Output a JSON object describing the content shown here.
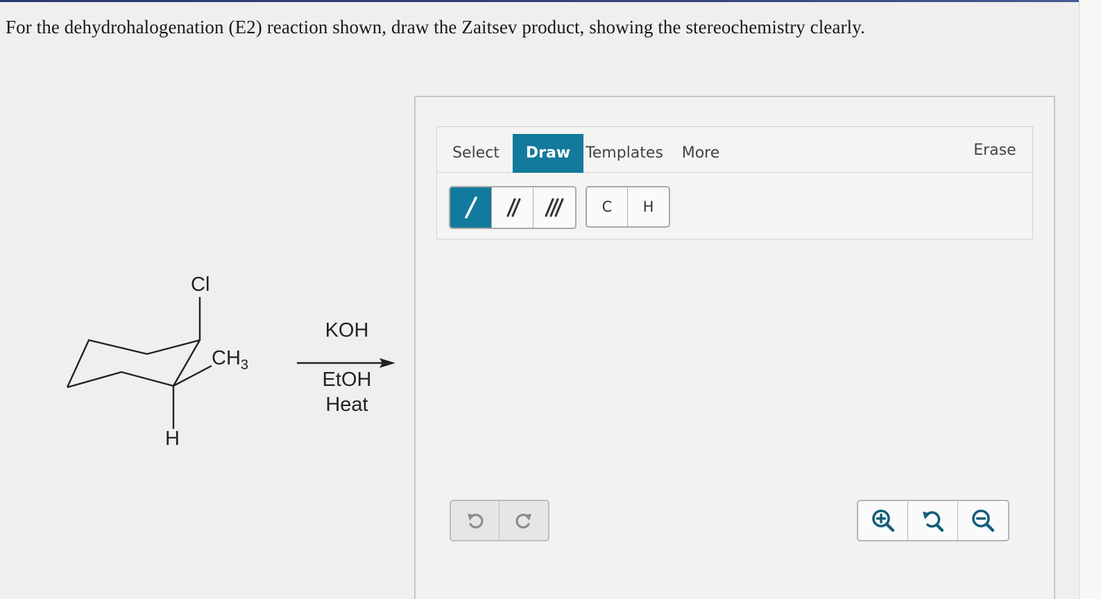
{
  "question": {
    "text": "For the dehydrohalogenation (E2) reaction shown, draw the Zaitsev product, showing the stereochemistry clearly."
  },
  "reactant": {
    "cl_label": "Cl",
    "ch3_label": "CH",
    "ch3_subscript": "3",
    "h_label": "H"
  },
  "reagents": {
    "above_arrow": "KOH",
    "below_arrow_1": "EtOH",
    "below_arrow_2": "Heat"
  },
  "editor": {
    "tabs": [
      {
        "label": "Select"
      },
      {
        "label": "Draw",
        "active": true
      },
      {
        "label": "Templates"
      },
      {
        "label": "More"
      }
    ],
    "erase_label": "Erase",
    "bond_tools": [
      {
        "name": "single-bond",
        "icon": "single-bond-icon",
        "active": true
      },
      {
        "name": "double-bond",
        "icon": "double-bond-icon"
      },
      {
        "name": "triple-bond",
        "icon": "triple-bond-icon"
      }
    ],
    "atom_tools": [
      {
        "label": "C"
      },
      {
        "label": "H"
      }
    ],
    "history": [
      {
        "icon": "undo-icon"
      },
      {
        "icon": "redo-icon"
      }
    ],
    "zoom": [
      {
        "icon": "zoom-in-icon"
      },
      {
        "icon": "zoom-reset-icon"
      },
      {
        "icon": "zoom-out-icon"
      }
    ],
    "accent_color": "#127a9c"
  }
}
